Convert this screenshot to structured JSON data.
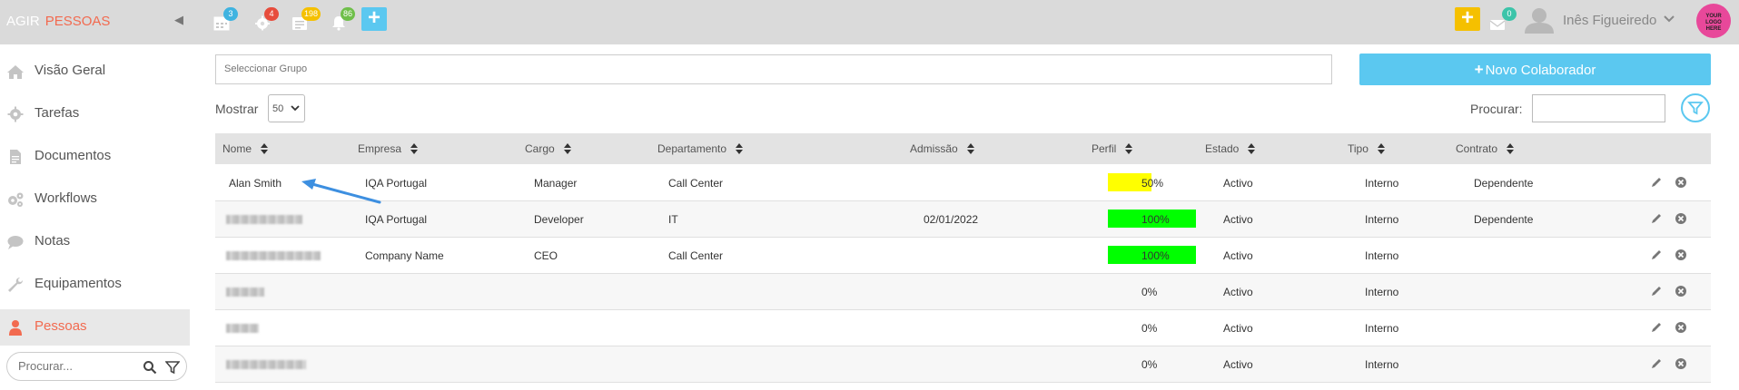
{
  "brand": {
    "part1": "AGIR",
    "part2": "PESSOAS"
  },
  "topbar": {
    "badges": {
      "calendar": "3",
      "gear": "4",
      "tasks": "198",
      "bell": "86",
      "messages": "0"
    },
    "add_label": "+",
    "user_name": "Inês Figueiredo",
    "logo_text": [
      "YOUR",
      "LOGO",
      "HERE"
    ]
  },
  "sidebar": {
    "items": [
      {
        "label": "Visão Geral",
        "icon": "home-icon"
      },
      {
        "label": "Tarefas",
        "icon": "gear-icon"
      },
      {
        "label": "Documentos",
        "icon": "document-icon"
      },
      {
        "label": "Workflows",
        "icon": "gears-icon"
      },
      {
        "label": "Notas",
        "icon": "comment-icon"
      },
      {
        "label": "Equipamentos",
        "icon": "wrench-icon"
      },
      {
        "label": "Pessoas",
        "icon": "person-icon"
      }
    ],
    "search_placeholder": "Procurar..."
  },
  "main": {
    "grupo_placeholder": "Seleccionar Grupo",
    "novo_label": "Novo Colaborador",
    "mostrar_label": "Mostrar",
    "mostrar_value": "50",
    "procurar_label": "Procurar:"
  },
  "table": {
    "headers": [
      "Nome",
      "Empresa",
      "Cargo",
      "Departamento",
      "Admissão",
      "Perfil",
      "Estado",
      "Tipo",
      "Contrato"
    ],
    "rows": [
      {
        "nome": "Alan Smith",
        "empresa": "IQA Portugal",
        "cargo": "Manager",
        "departamento": "Call Center",
        "admissao": "",
        "perfil": "50%",
        "perfil_value": 50,
        "estado": "Activo",
        "tipo": "Interno",
        "contrato": "Dependente"
      },
      {
        "nome": "",
        "empresa": "IQA Portugal",
        "cargo": "Developer",
        "departamento": "IT",
        "admissao": "02/01/2022",
        "perfil": "100%",
        "perfil_value": 100,
        "estado": "Activo",
        "tipo": "Interno",
        "contrato": "Dependente"
      },
      {
        "nome": "",
        "empresa": "Company Name",
        "cargo": "CEO",
        "departamento": "Call Center",
        "admissao": "",
        "perfil": "100%",
        "perfil_value": 100,
        "estado": "Activo",
        "tipo": "Interno",
        "contrato": ""
      },
      {
        "nome": "",
        "empresa": "",
        "cargo": "",
        "departamento": "",
        "admissao": "",
        "perfil": "0%",
        "perfil_value": 0,
        "estado": "Activo",
        "tipo": "Interno",
        "contrato": ""
      },
      {
        "nome": "",
        "empresa": "",
        "cargo": "",
        "departamento": "",
        "admissao": "",
        "perfil": "0%",
        "perfil_value": 0,
        "estado": "Activo",
        "tipo": "Interno",
        "contrato": ""
      },
      {
        "nome": "",
        "empresa": "",
        "cargo": "",
        "departamento": "",
        "admissao": "",
        "perfil": "0%",
        "perfil_value": 0,
        "estado": "Activo",
        "tipo": "Interno",
        "contrato": ""
      }
    ]
  },
  "colors": {
    "accent": "#5bc8f0",
    "brand_orange": "#f26a4f",
    "perfil_half": "#ffff00",
    "perfil_full": "#00ff00",
    "badge_calendar": "#3fb3e0",
    "badge_gear": "#e74c3c",
    "badge_tasks": "#f5c000",
    "badge_bell": "#6fbf4a",
    "badge_messages": "#3cc4a9"
  }
}
